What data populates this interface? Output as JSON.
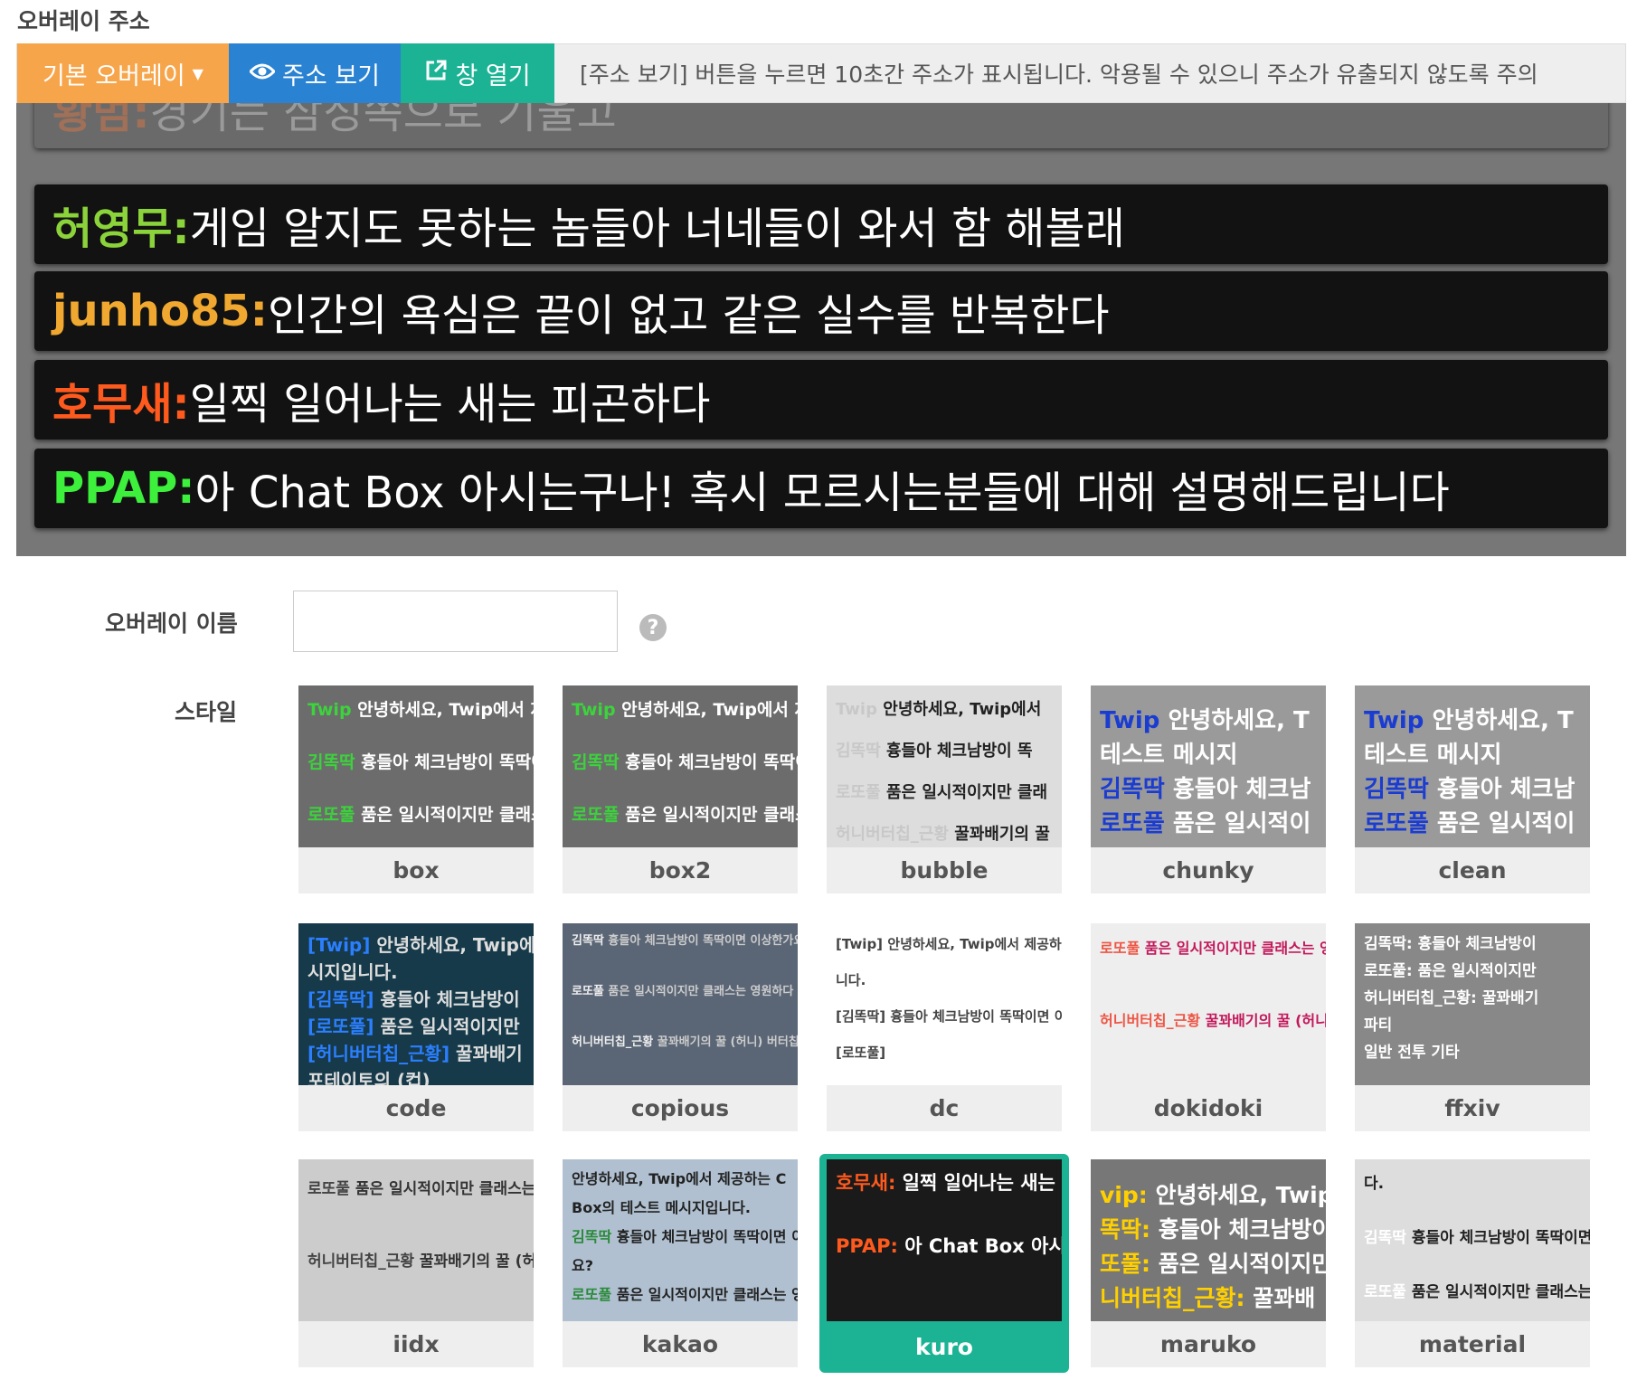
{
  "section_title": "오버레이 주소",
  "toolbar": {
    "overlay_menu_label": "기본 오버레이",
    "show_address_label": "주소 보기",
    "open_window_label": "창 열기",
    "hint": "[주소 보기] 버튼을 누르면 10초간 주소가 표시됩니다. 악용될 수 있으니 주소가 유출되지 않도록 주의"
  },
  "preview": {
    "messages": [
      {
        "nick": "황범",
        "text": "경기는 삼성쪽으로 기울고",
        "nick_color": "#b07050"
      },
      {
        "nick": "허영무",
        "text": "게임 알지도 못하는 놈들아 너네들이 와서 함 해볼래",
        "nick_color": "#8bd33a"
      },
      {
        "nick": "junho85",
        "text": "인간의 욕심은 끝이 없고 같은 실수를 반복한다",
        "nick_color": "#f0a830"
      },
      {
        "nick": "호무새",
        "text": "일찍 일어나는 새는 피곤하다",
        "nick_color": "#ff5a1e"
      },
      {
        "nick": "PPAP",
        "text": "아 Chat Box 아시는구나! 혹시 모르시는분들에 대해 설명해드립니다",
        "nick_color": "#3cf03c"
      }
    ]
  },
  "form": {
    "name_label": "오버레이 이름",
    "name_value": "",
    "help_glyph": "?",
    "style_label": "스타일"
  },
  "styles": [
    {
      "name": "box",
      "preview": [
        {
          "nick": "Twip",
          "text": "안녕하세요, Twip에서 제공하"
        },
        {
          "nick": "김똑딱",
          "text": "흉들아 체크남방이 똑딱이면 이"
        },
        {
          "nick": "로또풀",
          "text": "품은 일시적이지만 클래스는 영"
        }
      ]
    },
    {
      "name": "box2",
      "preview": [
        {
          "nick": "Twip",
          "text": "안녕하세요, Twip에서 제공하"
        },
        {
          "nick": "김똑딱",
          "text": "흉들아 체크남방이 똑딱이면 이"
        },
        {
          "nick": "로또풀",
          "text": "품은 일시적이지만 클래스는 영"
        }
      ]
    },
    {
      "name": "bubble",
      "preview": [
        {
          "nick": "Twip",
          "text": "안녕하세요, Twip에서"
        },
        {
          "nick": "김똑딱",
          "text": "흉들아 체크남방이 똑"
        },
        {
          "nick": "로또풀",
          "text": "품은 일시적이지만 클래"
        },
        {
          "nick": "허니버터칩_근황",
          "text": "꿀꽈배기의 꿀"
        }
      ]
    },
    {
      "name": "chunky",
      "preview": [
        {
          "nick": "Twip",
          "text": "안녕하세요, T"
        },
        {
          "nick": "",
          "text": "테스트 메시지"
        },
        {
          "nick": "김똑딱",
          "text": "흉들아 체크남"
        },
        {
          "nick": "로또풀",
          "text": "품은 일시적이"
        }
      ]
    },
    {
      "name": "clean",
      "preview": [
        {
          "nick": "Twip",
          "text": "안녕하세요, T"
        },
        {
          "nick": "",
          "text": "테스트 메시지"
        },
        {
          "nick": "김똑딱",
          "text": "흉들아 체크남"
        },
        {
          "nick": "로또풀",
          "text": "품은 일시적이"
        }
      ]
    },
    {
      "name": "code",
      "preview": [
        {
          "nick": "[Twip]",
          "text": "안녕하세요, Twip에"
        },
        {
          "nick": "",
          "text": "시지입니다."
        },
        {
          "nick": "[김똑딱]",
          "text": "흉들아 체크남방이"
        },
        {
          "nick": "[로또풀]",
          "text": "품은 일시적이지만"
        },
        {
          "nick": "[허니버터칩_근황]",
          "text": "꿀꽈배기"
        },
        {
          "nick": "",
          "text": "포테이토의 (컵)"
        }
      ]
    },
    {
      "name": "copious",
      "preview": [
        {
          "nick": "김똑딱",
          "text": "흉들아 체크남방이 똑딱이면 이상한가요?"
        },
        {
          "nick": "로또풀",
          "text": "품은 일시적이지만 클래스는 영원하다"
        },
        {
          "nick": "허니버터칩_근황",
          "text": "꿀꽈배기의 꿀 (허니) 버터칩의 (버터)"
        }
      ]
    },
    {
      "name": "dc",
      "preview": [
        {
          "nick": "[Twip]",
          "text": "안녕하세요, Twip에서 제공하는 Chat B"
        },
        {
          "nick": "",
          "text": "니다."
        },
        {
          "nick": "[김똑딱]",
          "text": "흉들아 체크남방이 똑딱이면 이상한가요"
        },
        {
          "nick": "[로또풀]",
          "text": ""
        }
      ]
    },
    {
      "name": "dokidoki",
      "preview": [
        {
          "nick": "로또풀",
          "text": "품은 일시적이지만 클래스는 영원하"
        },
        {
          "nick": "허니버터칩_근황",
          "text": "꿀꽈배기의 꿀 (허니) 버터칩의 (버터"
        }
      ]
    },
    {
      "name": "ffxiv",
      "preview": [
        {
          "nick": "",
          "text": "김똑딱: 흉들아 체크남방이"
        },
        {
          "nick": "",
          "text": "로또풀: 품은 일시적이지만"
        },
        {
          "nick": "",
          "text": "허니버터칩_근황: 꿀꽈배기"
        },
        {
          "nick": "",
          "text": "파티"
        },
        {
          "nick": "",
          "text": "일반  전투  기타"
        }
      ]
    },
    {
      "name": "iidx",
      "preview": [
        {
          "nick": "로또풀",
          "text": "품은 일시적이지만 클래스는"
        },
        {
          "nick": "허니버터칩_근황",
          "text": "꿀꽈배기의 꿀 (허니) 버터칩의"
        }
      ]
    },
    {
      "name": "kakao",
      "preview": [
        {
          "nick": "",
          "text": "안녕하세요, Twip에서 제공하는 C"
        },
        {
          "nick": "",
          "text": "Box의 테스트 메시지입니다."
        },
        {
          "nick": "김똑딱",
          "text": "흉들아 체크남방이 똑딱이면 이상한가"
        },
        {
          "nick": "",
          "text": "요?"
        },
        {
          "nick": "로또풀",
          "text": "품은 일시적이지만 클래스는 영원하"
        }
      ]
    },
    {
      "name": "kuro",
      "preview": [
        {
          "nick": "호무새",
          "text": "일찍 일어나는 새는 피곤하다"
        },
        {
          "nick": "PPAP",
          "text": "아 Chat Box 아시는구나! 혹시 모르시는분들에 대해 설명해드립니다"
        }
      ]
    },
    {
      "name": "maruko",
      "preview": [
        {
          "nick": "vip",
          "text": "안녕하세요, Twip에"
        },
        {
          "nick": "똑딱",
          "text": "흉들아 체크남방이"
        },
        {
          "nick": "또풀",
          "text": "품은 일시적이지만"
        },
        {
          "nick": "니버터칩_근황",
          "text": "꿀꽈배"
        }
      ]
    },
    {
      "name": "material",
      "preview": [
        {
          "nick": "",
          "text": "다."
        },
        {
          "nick": "김똑딱",
          "text": "흉들아 체크남방이 똑딱이면 이상"
        },
        {
          "nick": "로또풀",
          "text": "품은 일시적이지만 클래스는 영원"
        }
      ]
    }
  ],
  "selected_style": "kuro",
  "colors": {
    "orange": "#f7a54a",
    "blue": "#2a82d2",
    "teal": "#1bb394",
    "preview_bg": "#777777",
    "row_bg": "#121212"
  }
}
